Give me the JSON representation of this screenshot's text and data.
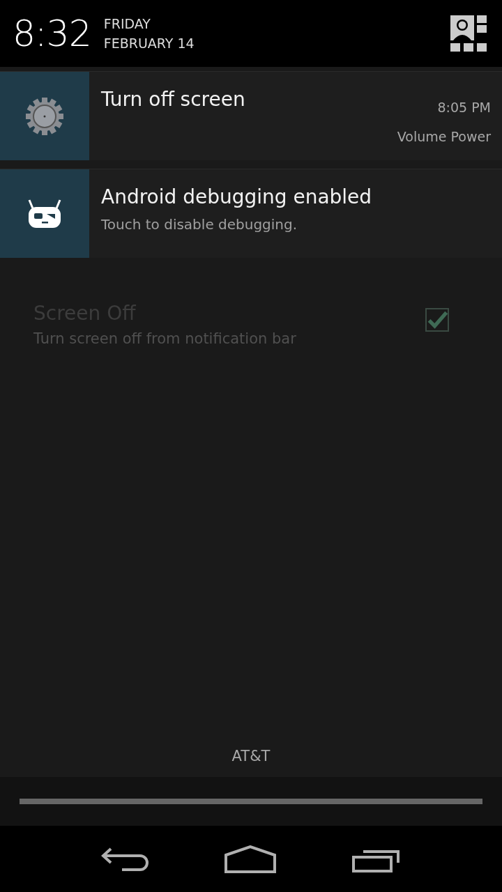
{
  "header": {
    "time": "8:32",
    "day": "FRIDAY",
    "date": "FEBRUARY 14"
  },
  "notifications": [
    {
      "kind": "gear",
      "title": "Turn off screen",
      "time": "8:05 PM",
      "info": "Volume Power"
    },
    {
      "kind": "robot",
      "title": "Android debugging enabled",
      "text": "Touch to disable debugging."
    }
  ],
  "background_setting": {
    "title": "Screen Off",
    "summary": "Turn screen off from notification bar",
    "checked": true
  },
  "carrier": "AT&T"
}
